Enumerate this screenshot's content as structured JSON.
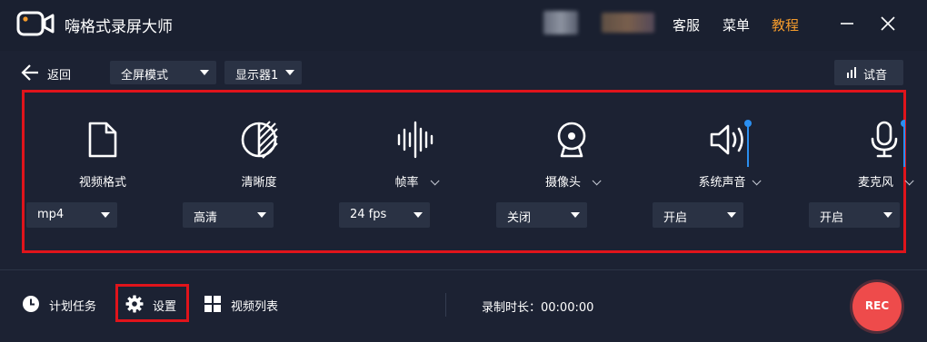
{
  "app": {
    "title": "嗨格式录屏大师"
  },
  "header": {
    "links": {
      "service": "客服",
      "menu": "菜单",
      "tutorial": "教程"
    },
    "colors": {
      "accent": "#f39a2c"
    }
  },
  "toolbar": {
    "back_label": "返回",
    "mode_select": "全屏模式",
    "display_select": "显示器1",
    "try_label": "试音"
  },
  "panel": {
    "columns": [
      {
        "label": "视频格式",
        "value": "mp4",
        "icon": "file-icon"
      },
      {
        "label": "清晰度",
        "value": "高清",
        "icon": "clarity-icon"
      },
      {
        "label": "帧率",
        "value": "24 fps",
        "icon": "waveform-icon"
      },
      {
        "label": "摄像头",
        "value": "关闭",
        "icon": "webcam-icon"
      },
      {
        "label": "系统声音",
        "value": "开启",
        "icon": "speaker-icon"
      },
      {
        "label": "麦克风",
        "value": "开启",
        "icon": "microphone-icon"
      }
    ],
    "colors": {
      "highlight": "#e0141b",
      "slider": "#2b8ff0"
    }
  },
  "bottom": {
    "schedule_label": "计划任务",
    "settings_label": "设置",
    "video_list_label": "视频列表",
    "rec_time": "录制时长：00:00:00",
    "rec_label": "REC",
    "colors": {
      "rec": "#ee4b4b"
    }
  }
}
